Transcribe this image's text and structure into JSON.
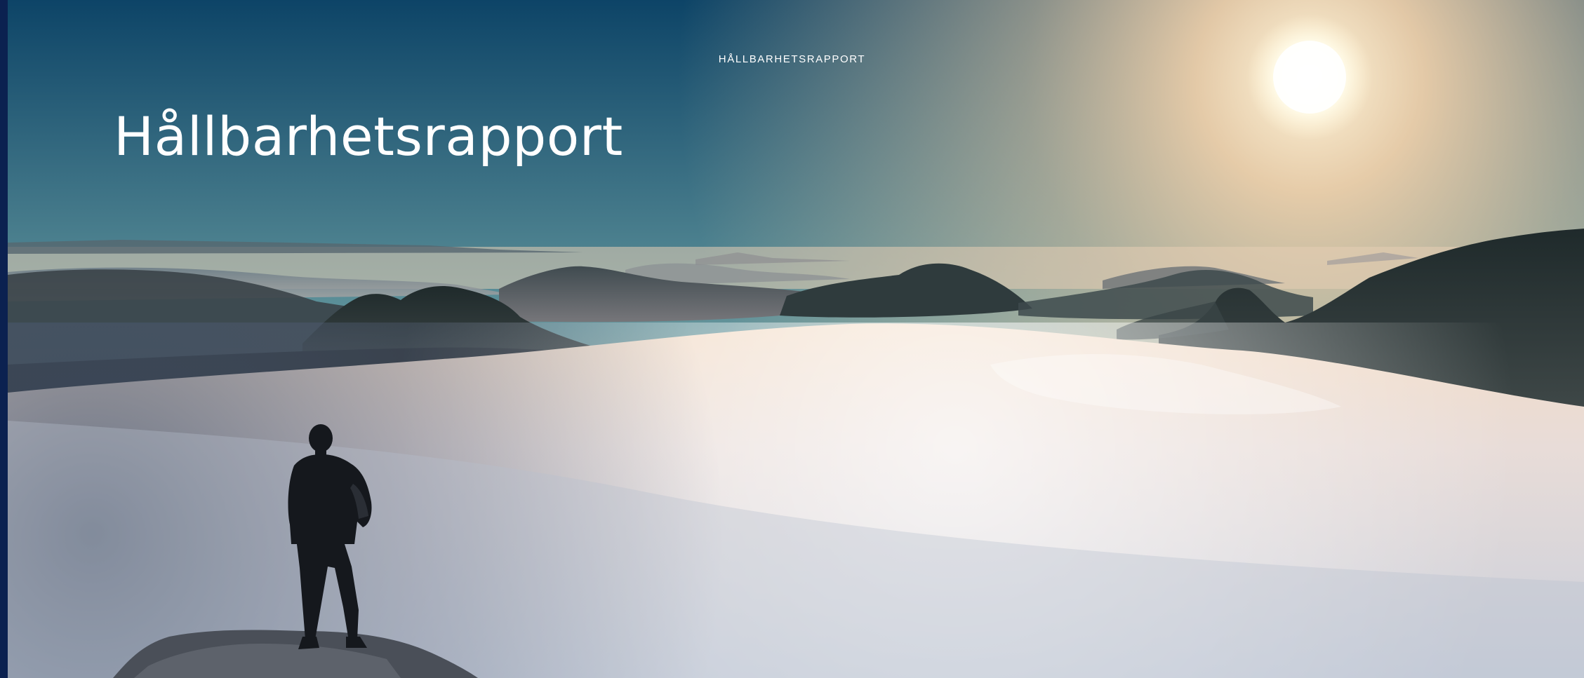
{
  "document": {
    "running_header": "HÅLLBARHETSRAPPORT",
    "title": "Hållbarhetsrapport"
  },
  "colors": {
    "left_strip": "#0b2150",
    "sky_top": "#0e4a6b",
    "sky_warm": "#f1dcbd",
    "sun": "#fffdf4",
    "fog": "#e9e6ea",
    "text": "#ffffff"
  },
  "hero_image": {
    "subject": "hiker-silhouette-above-fog",
    "sun_icon": "sun-icon"
  }
}
